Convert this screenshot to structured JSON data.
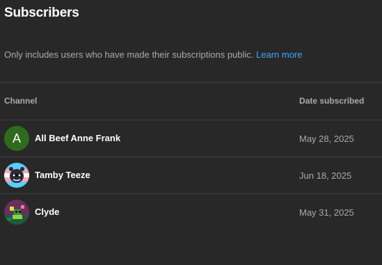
{
  "page": {
    "title": "Subscribers",
    "description": "Only includes users who have made their subscriptions public.",
    "learn_more": "Learn more"
  },
  "table": {
    "columns": [
      "Channel",
      "Date subscribed"
    ],
    "rows": [
      {
        "name": "All Beef Anne Frank",
        "date": "May 28, 2025",
        "avatar_letter": "A",
        "avatar_color": "#2e6b1f"
      },
      {
        "name": "Tamby Teeze",
        "date": "Jun 18, 2025",
        "avatar_icon": "cartoon-avatar-icon"
      },
      {
        "name": "Clyde",
        "date": "May 31, 2025",
        "avatar_icon": "pixel-art-avatar-icon"
      }
    ]
  },
  "colors": {
    "background": "#282828",
    "link": "#3ea6ff",
    "muted_text": "#aaaaaa",
    "divider": "#3f3f3f"
  }
}
